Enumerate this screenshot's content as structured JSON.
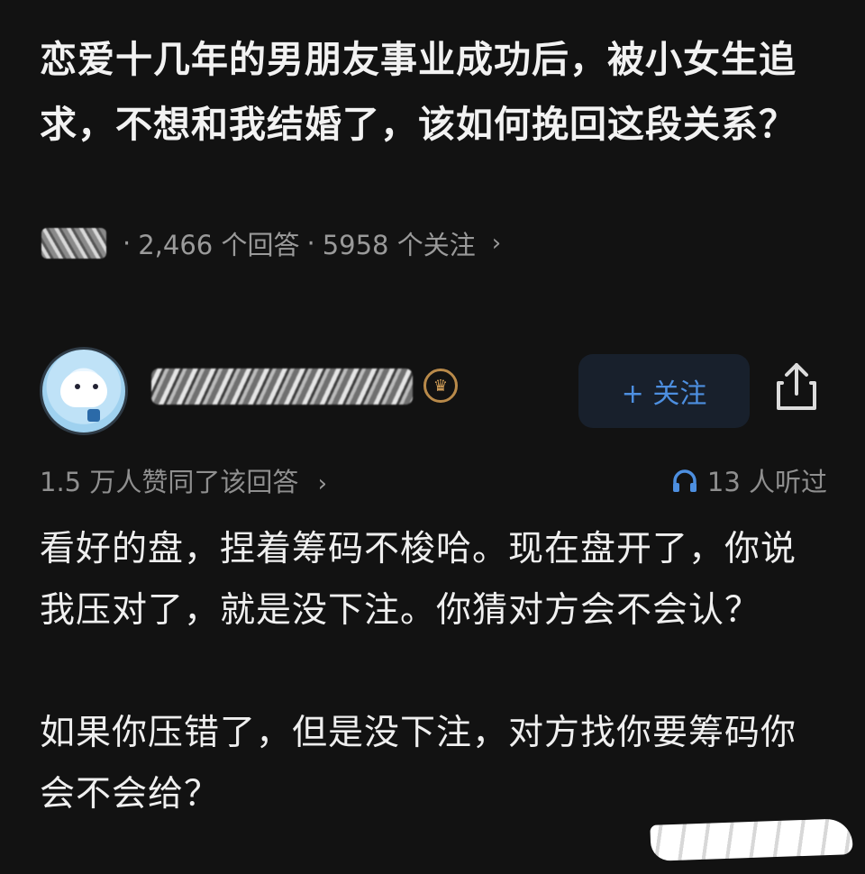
{
  "question": {
    "title": "恋爱十几年的男朋友事业成功后，被小女生追求，不想和我结婚了，该如何挽回这段关系？",
    "answers_count": "2,466 个回答",
    "follow_count": "5958 个关注"
  },
  "answer": {
    "follow_label": "+ 关注",
    "approval_text": "1.5 万人赞同了该回答",
    "listens_text": "13 人听过",
    "paragraphs": [
      "看好的盘，捏着筹码不梭哈。现在盘开了，你说我压对了，就是没下注。你猜对方会不会认？",
      "如果你压错了，但是没下注，对方找你要筹码你会不会给？"
    ]
  },
  "colors": {
    "background": "#121212",
    "accent_blue": "#4d8fe0",
    "badge_gold": "#b98a4a"
  },
  "icons": [
    "chevron-right-icon",
    "crown-badge-icon",
    "share-icon",
    "headphones-icon"
  ]
}
